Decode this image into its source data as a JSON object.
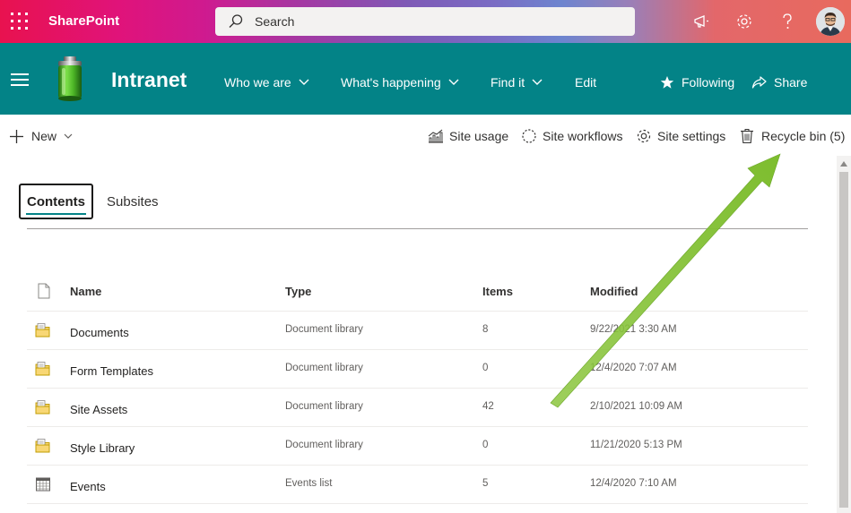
{
  "suite_bar": {
    "app_name": "SharePoint",
    "search_placeholder": "Search",
    "icons": [
      "waffle-icon",
      "search-icon",
      "megaphone-icon",
      "gear-icon",
      "help-icon",
      "avatar"
    ]
  },
  "site_header": {
    "title": "Intranet",
    "nav": [
      {
        "label": "Who we are",
        "has_menu": true
      },
      {
        "label": "What's happening",
        "has_menu": true
      },
      {
        "label": "Find it",
        "has_menu": true
      },
      {
        "label": "Edit",
        "has_menu": false
      }
    ],
    "following_label": "Following",
    "share_label": "Share"
  },
  "command_bar": {
    "new_label": "New",
    "site_usage_label": "Site usage",
    "site_workflows_label": "Site workflows",
    "site_settings_label": "Site settings",
    "recycle_bin_label": "Recycle bin (5)"
  },
  "pivot": {
    "tabs": [
      {
        "label": "Contents",
        "selected": true
      },
      {
        "label": "Subsites",
        "selected": false
      }
    ]
  },
  "table": {
    "headers": {
      "name": "Name",
      "type": "Type",
      "items": "Items",
      "modified": "Modified"
    },
    "rows": [
      {
        "icon": "document-library-icon",
        "name": "Documents",
        "type": "Document library",
        "items": "8",
        "modified": "9/22/2021 3:30 AM"
      },
      {
        "icon": "document-library-icon",
        "name": "Form Templates",
        "type": "Document library",
        "items": "0",
        "modified": "12/4/2020 7:07 AM"
      },
      {
        "icon": "document-library-icon",
        "name": "Site Assets",
        "type": "Document library",
        "items": "42",
        "modified": "2/10/2021 10:09 AM"
      },
      {
        "icon": "document-library-icon",
        "name": "Style Library",
        "type": "Document library",
        "items": "0",
        "modified": "11/21/2020 5:13 PM"
      },
      {
        "icon": "calendar-icon",
        "name": "Events",
        "type": "Events list",
        "items": "5",
        "modified": "12/4/2020 7:10 AM"
      }
    ]
  },
  "colors": {
    "header_teal": "#038387",
    "annotation_arrow": "#8cc63f"
  }
}
